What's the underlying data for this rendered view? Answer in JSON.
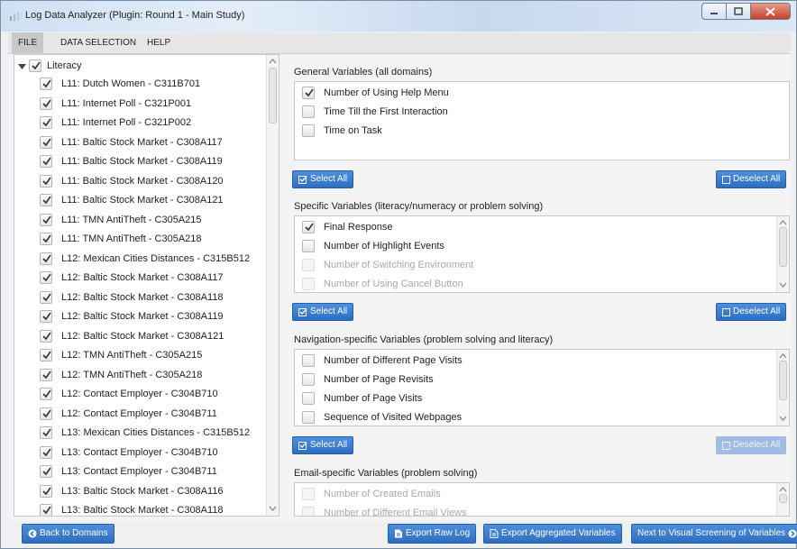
{
  "window": {
    "title": "Log Data Analyzer (Plugin: Round 1 - Main Study)"
  },
  "menu": {
    "items": [
      "FILE",
      "DATA SELECTION",
      "HELP"
    ],
    "active": "FILE"
  },
  "tree": {
    "root_label": "Literacy",
    "root_checked": true,
    "items": [
      "L11: Dutch Women - C311B701",
      "L11: Internet Poll - C321P001",
      "L11: Internet Poll - C321P002",
      "L11: Baltic Stock Market - C308A117",
      "L11: Baltic Stock Market - C308A119",
      "L11: Baltic Stock Market - C308A120",
      "L11: Baltic Stock Market - C308A121",
      "L11: TMN AntiTheft - C305A215",
      "L11: TMN AntiTheft - C305A218",
      "L12: Mexican Cities Distances - C315B512",
      "L12: Baltic Stock Market - C308A117",
      "L12: Baltic Stock Market - C308A118",
      "L12: Baltic Stock Market - C308A119",
      "L12: Baltic Stock Market - C308A121",
      "L12: TMN AntiTheft - C305A215",
      "L12: TMN AntiTheft - C305A218",
      "L12: Contact Employer - C304B710",
      "L12: Contact Employer - C304B711",
      "L13: Mexican Cities Distances - C315B512",
      "L13: Contact Employer - C304B710",
      "L13: Contact Employer - C304B711",
      "L13: Baltic Stock Market - C308A116",
      "L13: Baltic Stock Market - C308A118"
    ]
  },
  "sections": {
    "general": {
      "label": "General Variables (all domains)",
      "items": [
        {
          "label": "Number of Using Help Menu",
          "checked": true,
          "disabled": false
        },
        {
          "label": "Time Till the First Interaction",
          "checked": false,
          "disabled": false
        },
        {
          "label": "Time on Task",
          "checked": false,
          "disabled": false
        }
      ],
      "select_all": "Select All",
      "deselect_all": "Deselect All"
    },
    "specific": {
      "label": "Specific Variables (literacy/numeracy or problem solving)",
      "items": [
        {
          "label": "Final Response",
          "checked": true,
          "disabled": false
        },
        {
          "label": "Number of Highlight Events",
          "checked": false,
          "disabled": false
        },
        {
          "label": "Number of Switching Environment",
          "checked": false,
          "disabled": true
        },
        {
          "label": "Number of Using Cancel Button",
          "checked": false,
          "disabled": true
        }
      ],
      "select_all": "Select All",
      "deselect_all": "Deselect All"
    },
    "navigation": {
      "label": "Navigation-specific Variables (problem solving and literacy)",
      "items": [
        {
          "label": "Number of Different Page Visits",
          "checked": false,
          "disabled": false
        },
        {
          "label": "Number of Page Revisits",
          "checked": false,
          "disabled": false
        },
        {
          "label": "Number of Page Visits",
          "checked": false,
          "disabled": false
        },
        {
          "label": "Sequence of Visited Webpages",
          "checked": false,
          "disabled": false
        }
      ],
      "select_all": "Select All",
      "deselect_all": "Deselect All"
    },
    "email": {
      "label": "Email-specific Variables (problem solving)",
      "items": [
        {
          "label": "Number of Created Emails",
          "checked": false,
          "disabled": true
        },
        {
          "label": "Number of Different Email Views",
          "checked": false,
          "disabled": true
        }
      ]
    }
  },
  "footer": {
    "back": "Back to Domains",
    "export_raw": "Export Raw Log",
    "export_agg": "Export Aggregated Variables",
    "next": "Next to Visual Screening of Variables"
  },
  "colors": {
    "accent": "#2e6ec2",
    "accent_disabled": "#9fbde2"
  }
}
